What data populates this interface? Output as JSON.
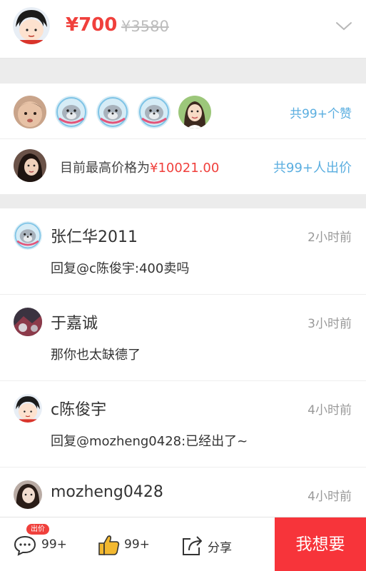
{
  "header": {
    "price": "¥700",
    "original_price": "¥3580",
    "chevron_icon": "chevron-down-icon"
  },
  "likes": {
    "count_label": "共99+个赞",
    "avatars": [
      "baby-photo",
      "seal-avatar",
      "seal-avatar",
      "seal-avatar",
      "girl-photo"
    ]
  },
  "bid": {
    "prefix": "目前最高价格为",
    "price": "¥10021.00",
    "count_label": "共99+人出价"
  },
  "comments": [
    {
      "name": "张仁华2011",
      "time": "2小时前",
      "text": "回复@c陈俊宇:400卖吗",
      "avatar": "seal-avatar"
    },
    {
      "name": "于嘉诚",
      "time": "3小时前",
      "text": "那你也太缺德了",
      "avatar": "photo-avatar"
    },
    {
      "name": "c陈俊宇",
      "time": "4小时前",
      "text": "回复@mozheng0428:已经出了~",
      "avatar": "cartoon-avatar"
    },
    {
      "name": "mozheng0428",
      "time": "4小时前",
      "text": "",
      "avatar": "photo-avatar"
    }
  ],
  "bottom_bar": {
    "comment_badge": "出价",
    "comment_count": "99+",
    "like_count": "99+",
    "share_label": "分享",
    "want_label": "我想要"
  },
  "colors": {
    "accent_red": "#f0403c",
    "link_blue": "#5aaee0",
    "want_button": "#f7343a"
  }
}
